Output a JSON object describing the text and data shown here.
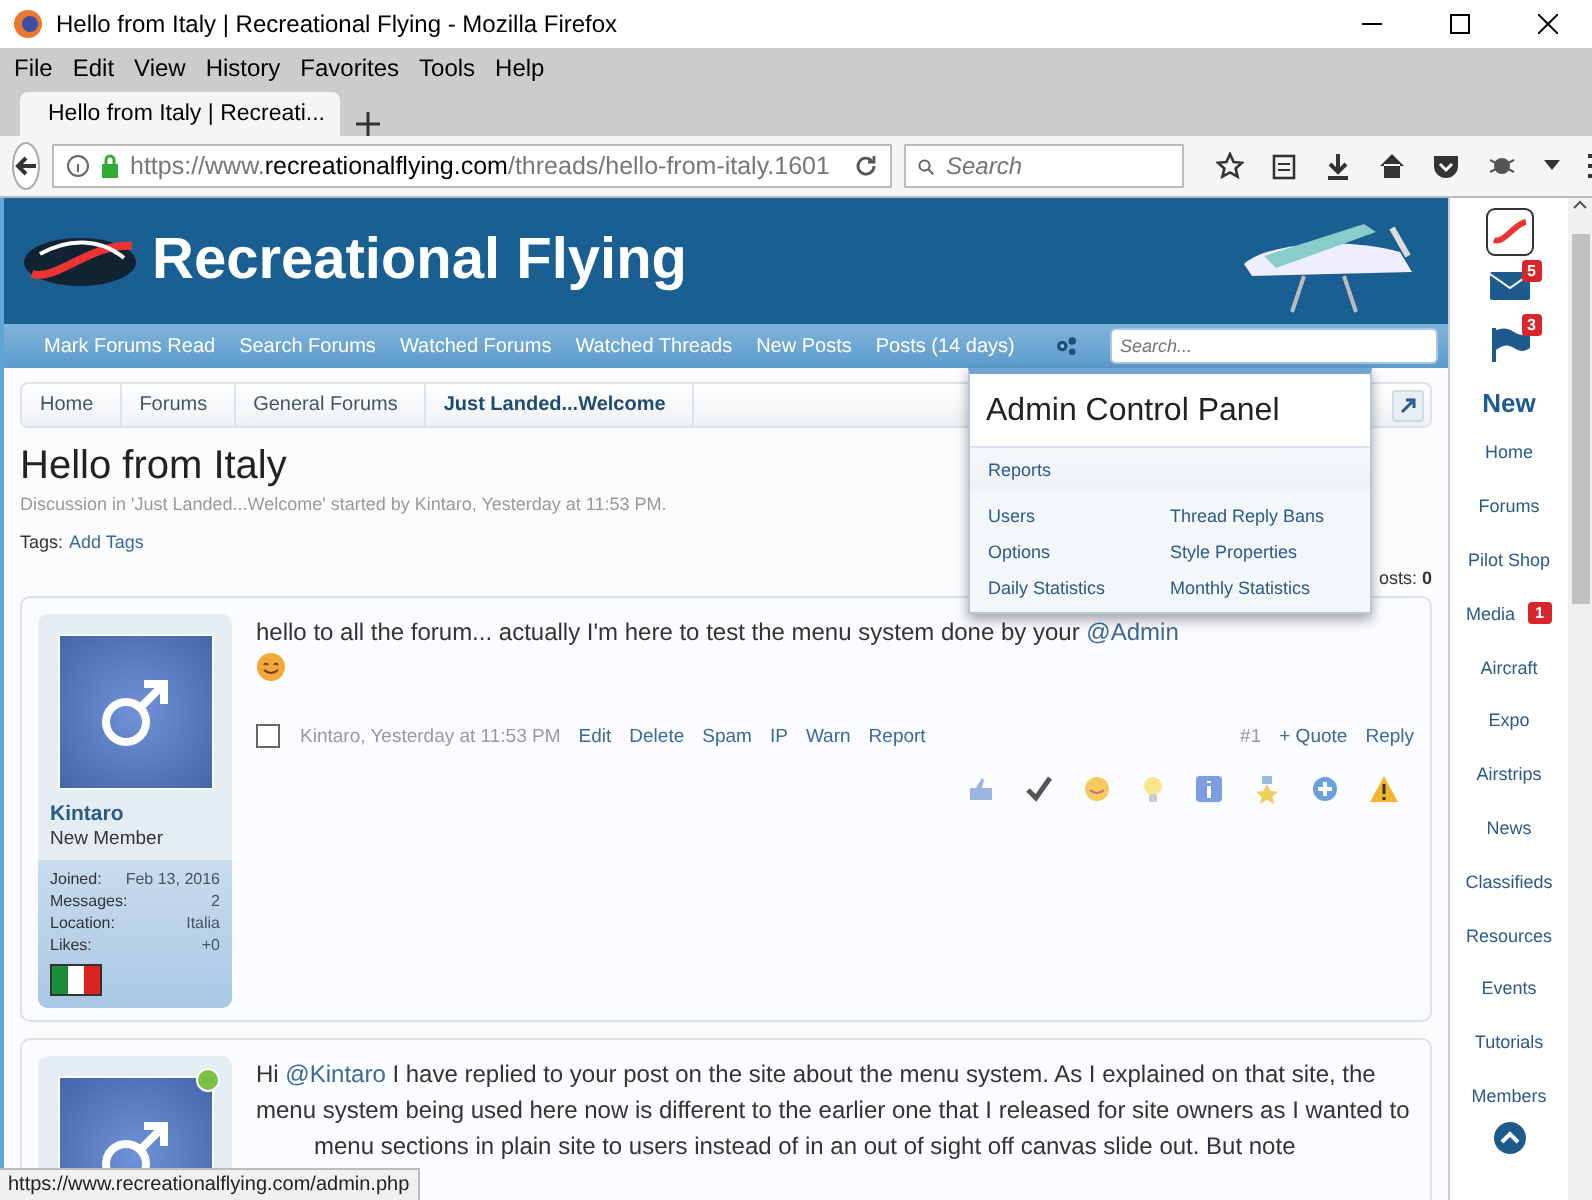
{
  "window": {
    "title": "Hello from Italy | Recreational Flying - Mozilla Firefox"
  },
  "menu_bar": [
    "File",
    "Edit",
    "View",
    "History",
    "Favorites",
    "Tools",
    "Help"
  ],
  "tabs": [
    {
      "label": "Hello from Italy | Recreati...",
      "selected": true
    }
  ],
  "address_bar": {
    "url_prefix": "https://www.",
    "url_domain": "recreationalflying.com",
    "url_path": "/threads/hello-from-italy.1601"
  },
  "browser_search": {
    "placeholder": "Search"
  },
  "site": {
    "title": "Recreational Flying"
  },
  "nav_links": [
    "Mark Forums Read",
    "Search Forums",
    "Watched Forums",
    "Watched Threads",
    "New Posts",
    "Posts (14 days)"
  ],
  "site_search": {
    "placeholder": "Search..."
  },
  "breadcrumbs": [
    {
      "label": "Home",
      "selected": false
    },
    {
      "label": "Forums",
      "selected": false
    },
    {
      "label": "General Forums",
      "selected": false
    },
    {
      "label": "Just Landed...Welcome",
      "selected": true
    }
  ],
  "thread": {
    "title": "Hello from Italy",
    "meta": "Discussion in 'Just Landed...Welcome' started by Kintaro, Yesterday at 11:53 PM.",
    "tags_label": "Tags:",
    "add_tags": "Add Tags",
    "posts_count": "osts: **0**"
  },
  "admin_menu": {
    "title": "Admin Control Panel",
    "header_item": "Reports",
    "items": [
      "Users",
      "Thread Reply Bans",
      "Options",
      "Style Properties",
      "Daily Statistics",
      "Monthly Statistics"
    ]
  },
  "posts": [
    {
      "author": "Kintaro",
      "role": "New Member",
      "online": false,
      "stats": [
        {
          "label": "Joined:",
          "value": "Feb 13, 2016"
        },
        {
          "label": "Messages:",
          "value": "2"
        },
        {
          "label": "Location:",
          "value": "Italia"
        },
        {
          "label": "Likes:",
          "value": "+0"
        }
      ],
      "body": [
        {
          "kind": "text",
          "text": "hello to all the forum... actually I'm here to test the menu system done by your "
        },
        {
          "kind": "mention",
          "text": "@Admin"
        }
      ],
      "selected": false,
      "byline": "Kintaro, Yesterday at 11:53 PM",
      "actions": [
        "Edit",
        "Delete",
        "Spam",
        "IP",
        "Warn",
        "Report"
      ],
      "number": "#1",
      "quote": "+ Quote",
      "reply": "Reply"
    },
    {
      "online": true,
      "body": [
        {
          "kind": "text",
          "text": "Hi "
        },
        {
          "kind": "mention",
          "text": "@Kintaro"
        },
        {
          "kind": "text",
          "text": " I have replied to your post on the site about the menu system. As I explained on that site, the menu system being used here now is different to the earlier one that I released for site owners as I wanted to"
        }
      ],
      "continued": "menu sections in plain site to users instead of in an out of sight off canvas slide out. But note"
    }
  ],
  "side_nav": {
    "mail_badge": "5",
    "alerts_badge": "3",
    "new_label": "New",
    "items": [
      {
        "label": "Home"
      },
      {
        "label": "Forums"
      },
      {
        "label": "Pilot Shop"
      },
      {
        "label": "Media",
        "badge": "1"
      },
      {
        "label": "Aircraft"
      },
      {
        "label": "Expo"
      },
      {
        "label": "Airstrips"
      },
      {
        "label": "News"
      },
      {
        "label": "Classifieds"
      },
      {
        "label": "Resources"
      },
      {
        "label": "Events"
      },
      {
        "label": "Tutorials"
      },
      {
        "label": "Members"
      }
    ]
  },
  "status_bar": {
    "text": "https://www.recreationalflying.com/admin.php"
  }
}
